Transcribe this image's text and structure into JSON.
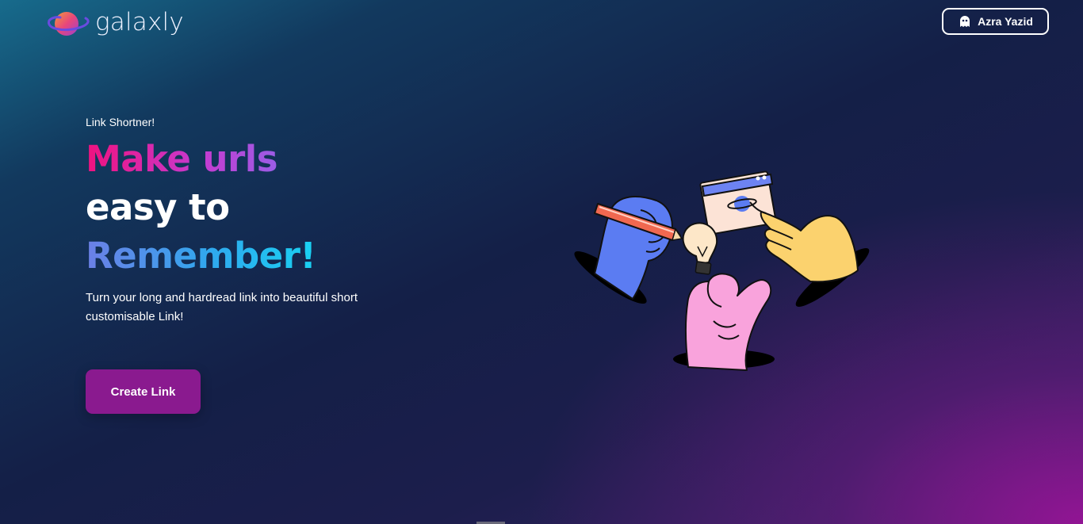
{
  "header": {
    "brand": "galaxly",
    "user": {
      "name": "Azra Yazid",
      "icon": "ghost-icon"
    }
  },
  "hero": {
    "kicker": "Link Shortner!",
    "headline": {
      "line1": "Make urls",
      "line2": "easy to",
      "line3": "Remember!"
    },
    "tagline": "Turn your long and hardread link into beautiful short customisable Link!",
    "cta_label": "Create Link"
  },
  "colors": {
    "cta": "#8a1a8f",
    "headline_pink": "#f0127f",
    "headline_blue": "#19d1f2"
  }
}
